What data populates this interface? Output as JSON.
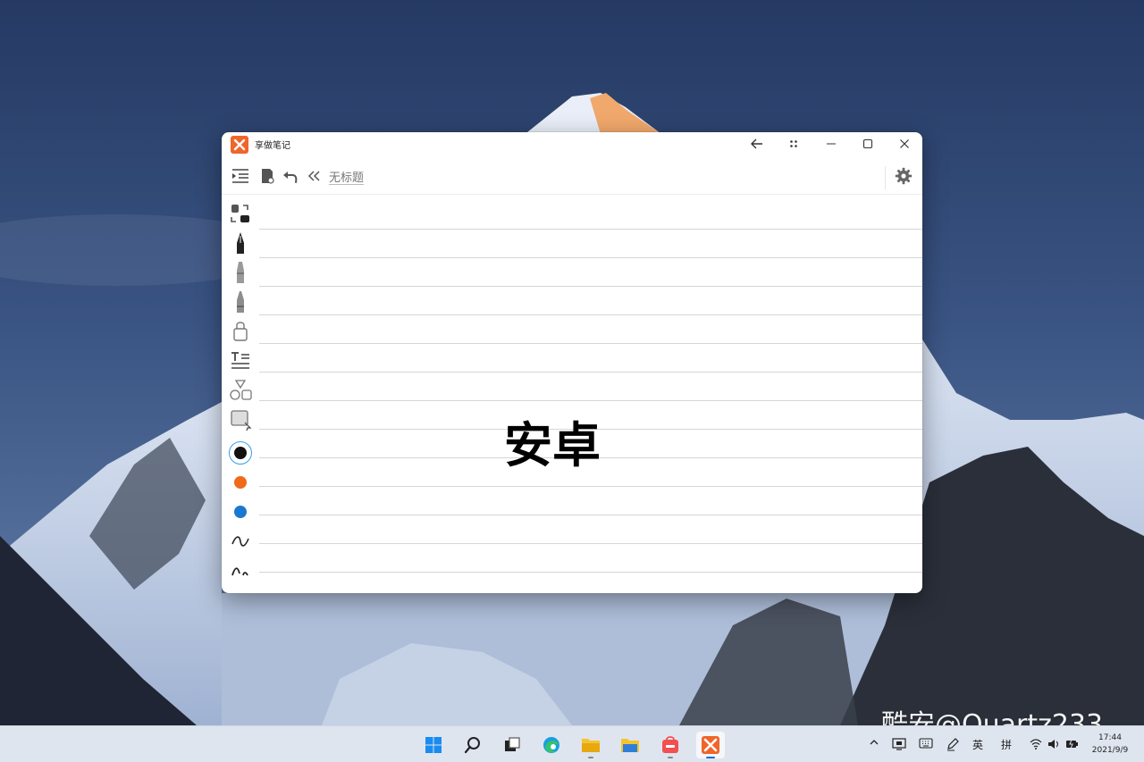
{
  "window": {
    "app_name": "享做笔记",
    "note_title": "无标题",
    "handwriting": "安卓"
  },
  "side_tools": [
    {
      "icon": "layout-toggle-icon"
    },
    {
      "icon": "fountain-pen-icon"
    },
    {
      "icon": "marker-icon"
    },
    {
      "icon": "highlighter-icon"
    },
    {
      "icon": "eraser-icon"
    },
    {
      "icon": "text-tool-icon"
    },
    {
      "icon": "shapes-icon"
    },
    {
      "icon": "lasso-select-icon"
    }
  ],
  "colors": {
    "selected": "#111111",
    "palette": [
      "#111111",
      "#f06a1a",
      "#1a78d0"
    ],
    "accent": "#f0652a"
  },
  "stroke_styles": [
    "wave-stroke-icon",
    "wave-stroke-small-icon"
  ],
  "watermark": "酷安@Quartz233",
  "taskbar": {
    "apps": [
      "start-icon",
      "search-icon",
      "task-view-icon",
      "edge-icon",
      "file-explorer-icon",
      "folder-icon",
      "store-icon",
      "notes-app-icon"
    ],
    "tray": {
      "input_lang": "英",
      "ime": "拼"
    },
    "time": "17:44",
    "date": "2021/9/9"
  }
}
